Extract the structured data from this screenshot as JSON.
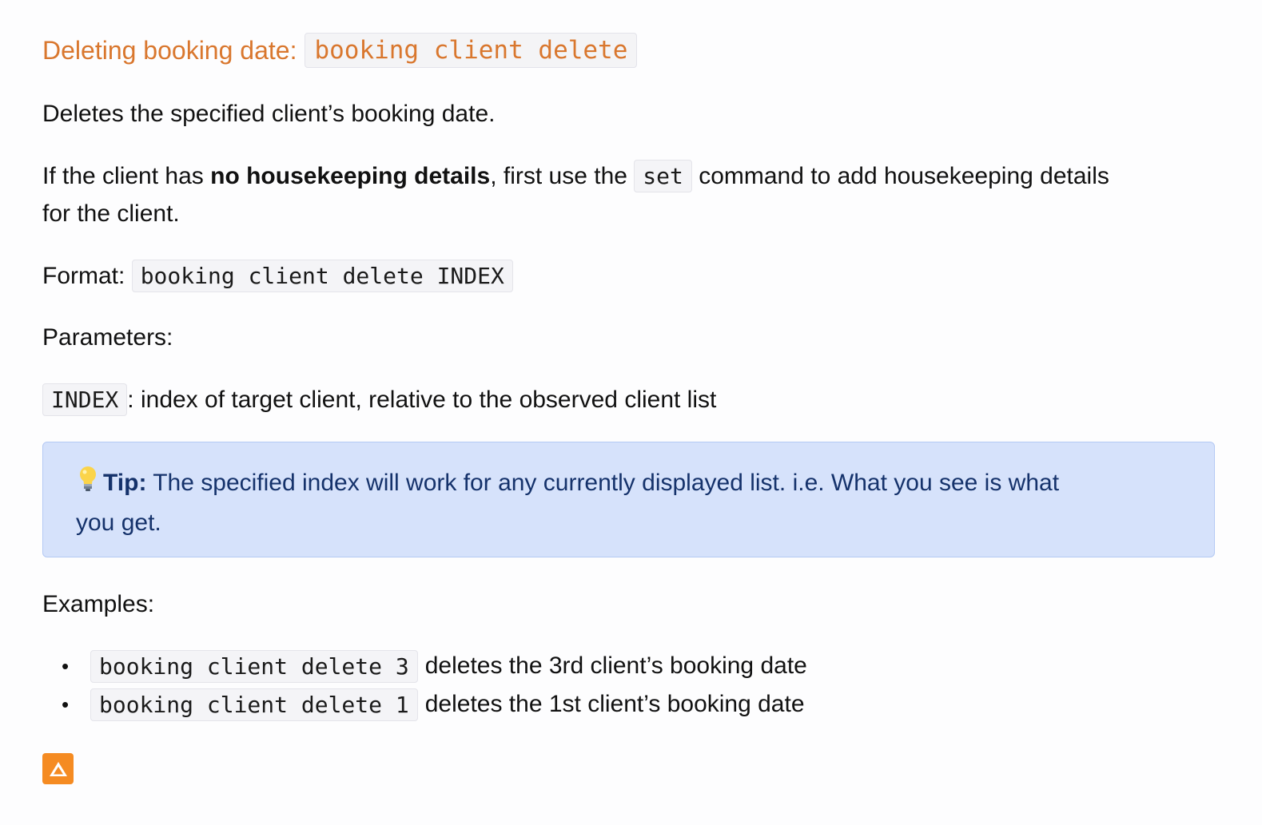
{
  "heading": {
    "label": "Deleting booking date:",
    "code": "booking client delete"
  },
  "description": "Deletes the specified client’s booking date.",
  "precondition": {
    "pre": "If the client has ",
    "bold": "no housekeeping details",
    "mid": ", first use the ",
    "code": "set",
    "post": " command to add housekeeping details",
    "line2": "for the client."
  },
  "format": {
    "label": "Format:",
    "code": "booking client delete INDEX"
  },
  "parameters_label": "Parameters:",
  "parameter": {
    "code": "INDEX",
    "text": ": index of target client, relative to the observed client list"
  },
  "tip": {
    "icon": "lightbulb-icon",
    "label": "Tip:",
    "text": " The specified index will work for any currently displayed list. i.e. What you see is what",
    "line2": "you get."
  },
  "examples_label": "Examples:",
  "examples": [
    {
      "bullet": "•",
      "code": "booking client delete 3",
      "text": "deletes the 3rd client’s booking date"
    },
    {
      "bullet": "•",
      "code": "booking client delete 1",
      "text": "deletes the 1st client’s booking date"
    }
  ],
  "back_to_top": {
    "icon": "up-arrow-icon",
    "color": "#f58b22"
  },
  "colors": {
    "heading": "#d9772e",
    "tip_background": "#d6e2fb",
    "tip_text": "#15326b"
  }
}
